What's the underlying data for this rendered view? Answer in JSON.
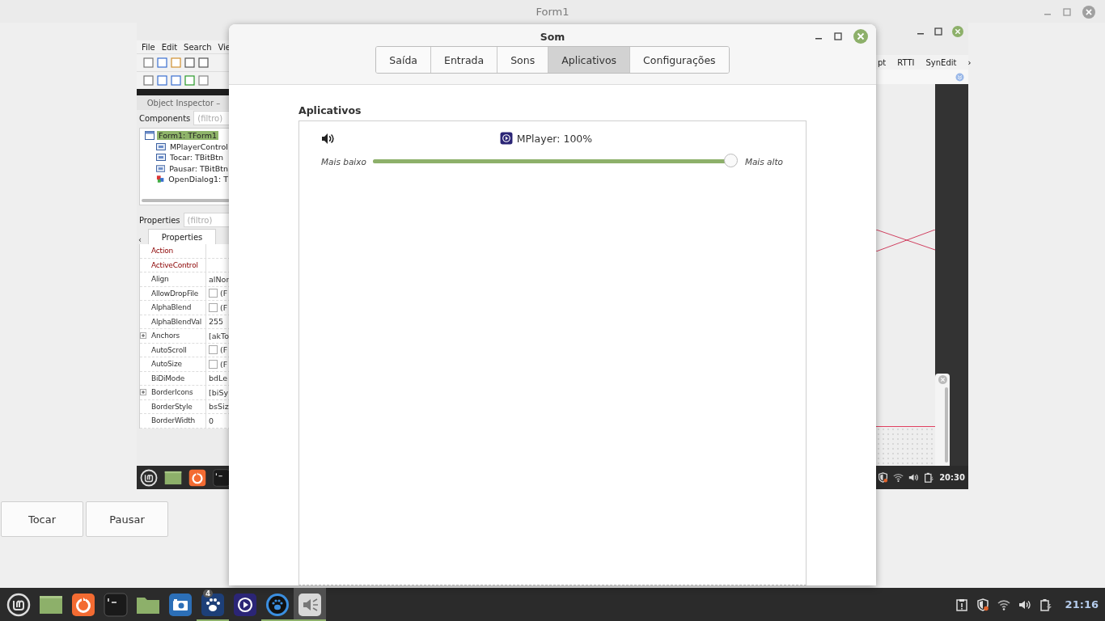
{
  "form_window": {
    "title": "Form1",
    "buttons": [
      {
        "label": "Tocar"
      },
      {
        "label": "Pausar"
      }
    ]
  },
  "screenshot": {
    "menu": [
      "File",
      "Edit",
      "Search",
      "Vie"
    ],
    "inspector": {
      "title": "Object Inspector –",
      "components_label": "Components",
      "components_filter": "(filtro)",
      "tree": [
        {
          "label": "Form1: TForm1",
          "selected": true,
          "kind": "form",
          "children": [
            {
              "label": "MPlayerControl",
              "selected": false,
              "kind": "control"
            },
            {
              "label": "Tocar: TBitBtn",
              "selected": false,
              "kind": "control"
            },
            {
              "label": "Pausar: TBitBtn",
              "selected": false,
              "kind": "control"
            },
            {
              "label": "OpenDialog1: T",
              "selected": false,
              "kind": "dialog"
            }
          ]
        }
      ],
      "properties_label": "Properties",
      "properties_filter": "(filtro)",
      "tabs_back": "‹",
      "properties_tab": "Properties",
      "properties": [
        {
          "name": "Action",
          "highlighted": true,
          "expandable": false,
          "kind": "text"
        },
        {
          "name": "ActiveControl",
          "highlighted": true,
          "expandable": false,
          "kind": "text"
        },
        {
          "name": "Align",
          "value": "alNor",
          "highlighted": false,
          "expandable": false,
          "kind": "text"
        },
        {
          "name": "AllowDropFile",
          "value": "(F",
          "highlighted": false,
          "expandable": false,
          "kind": "check",
          "checked": false
        },
        {
          "name": "AlphaBlend",
          "value": "(F",
          "highlighted": false,
          "expandable": false,
          "kind": "check",
          "checked": false
        },
        {
          "name": "AlphaBlendVal",
          "value": "255",
          "highlighted": false,
          "expandable": false,
          "kind": "text"
        },
        {
          "name": "Anchors",
          "value": "[akTo",
          "highlighted": false,
          "expandable": true,
          "kind": "text"
        },
        {
          "name": "AutoScroll",
          "value": "(F",
          "highlighted": false,
          "expandable": false,
          "kind": "check",
          "checked": false
        },
        {
          "name": "AutoSize",
          "value": "(F",
          "highlighted": false,
          "expandable": false,
          "kind": "check",
          "checked": false
        },
        {
          "name": "BiDiMode",
          "value": "bdLe",
          "highlighted": false,
          "expandable": false,
          "kind": "text"
        },
        {
          "name": "BorderIcons",
          "value": "[biSy",
          "highlighted": false,
          "expandable": true,
          "kind": "text"
        },
        {
          "name": "BorderStyle",
          "value": "bsSiz",
          "highlighted": false,
          "expandable": false,
          "kind": "text"
        },
        {
          "name": "BorderWidth",
          "value": "0",
          "highlighted": false,
          "expandable": false,
          "kind": "text"
        }
      ]
    },
    "right_menu": [
      "pt",
      "RTTI",
      "SynEdit"
    ],
    "right_menu_more": "›",
    "taskbar_items": [
      {
        "kind": "mint"
      },
      {
        "kind": "files"
      },
      {
        "kind": "firefox"
      },
      {
        "kind": "terminal"
      }
    ],
    "tray": [
      {
        "kind": "shield"
      },
      {
        "kind": "wifi"
      },
      {
        "kind": "volume"
      },
      {
        "kind": "battery"
      }
    ],
    "clock": "20:30"
  },
  "sound_dialog": {
    "title": "Som",
    "tabs": [
      {
        "label": "Saída",
        "selected": false
      },
      {
        "label": "Entrada",
        "selected": false
      },
      {
        "label": "Sons",
        "selected": false
      },
      {
        "label": "Aplicativos",
        "selected": true
      },
      {
        "label": "Configurações",
        "selected": false
      }
    ],
    "section_title": "Aplicativos",
    "applications": [
      {
        "name": "MPlayer: 100%",
        "level": 1.0,
        "low_label": "Mais baixo",
        "high_label": "Mais alto"
      }
    ]
  },
  "taskbar": {
    "items": [
      {
        "kind": "mint",
        "running": false,
        "active": false
      },
      {
        "kind": "files",
        "running": false,
        "active": false
      },
      {
        "kind": "firefox",
        "running": false,
        "active": false
      },
      {
        "kind": "terminal",
        "running": false,
        "active": false
      },
      {
        "kind": "folder",
        "running": false,
        "active": false
      },
      {
        "kind": "camera",
        "running": false,
        "active": false
      },
      {
        "kind": "paw",
        "running": true,
        "active": false,
        "badge": "4"
      },
      {
        "kind": "mplayer",
        "running": false,
        "active": false
      },
      {
        "kind": "pawblack",
        "running": true,
        "active": false
      },
      {
        "kind": "sound",
        "running": true,
        "active": true
      }
    ],
    "tray": [
      {
        "kind": "clipboard"
      },
      {
        "kind": "shield"
      },
      {
        "kind": "wifi"
      },
      {
        "kind": "volume"
      },
      {
        "kind": "battery"
      }
    ],
    "clock": "21:16"
  }
}
